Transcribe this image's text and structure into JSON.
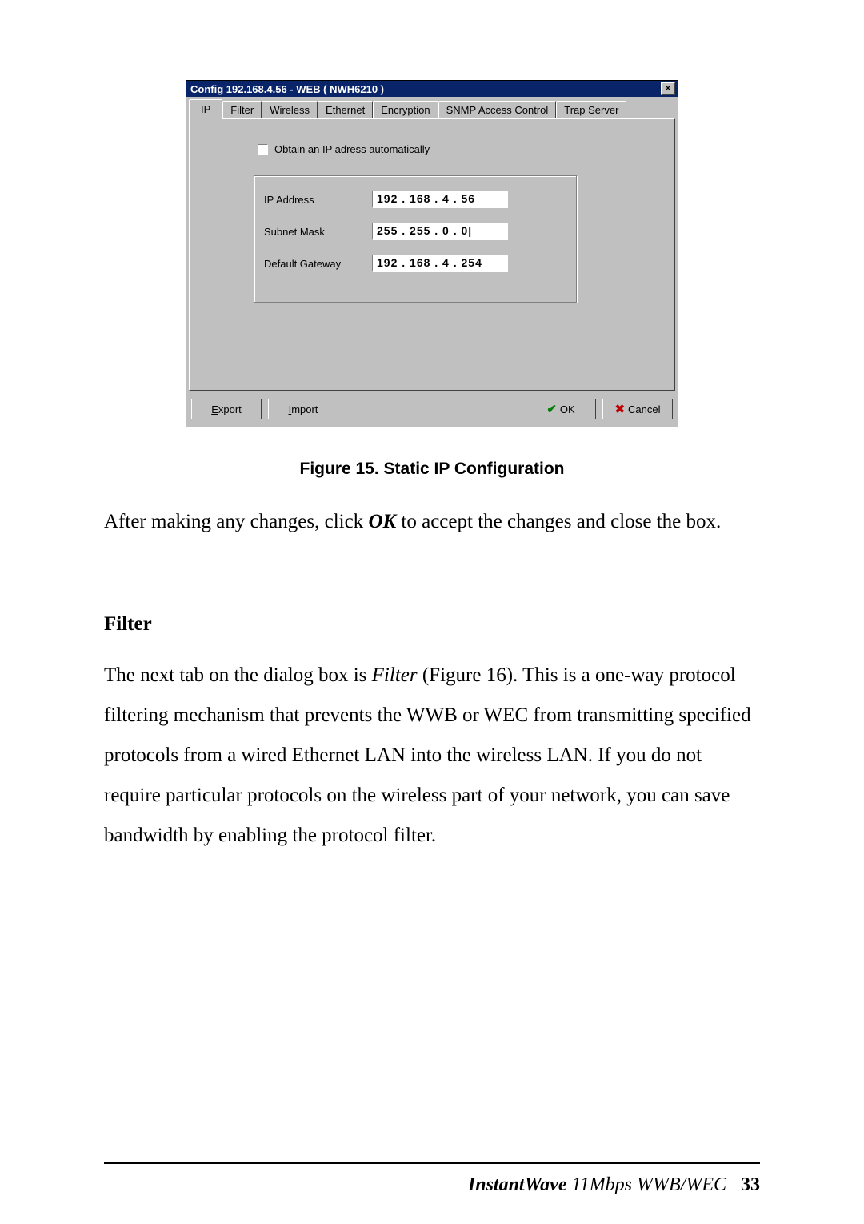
{
  "dialog": {
    "title": "Config 192.168.4.56 - WEB ( NWH6210 )",
    "tabs": [
      "IP",
      "Filter",
      "Wireless",
      "Ethernet",
      "Encryption",
      "SNMP Access Control",
      "Trap Server"
    ],
    "active_tab_index": 0,
    "checkbox_label": "Obtain an IP adress automatically",
    "fields": {
      "ip_label": "IP Address",
      "ip_value": "192 . 168 .  4  . 56",
      "mask_label": "Subnet Mask",
      "mask_value": "255 . 255 .  0  .  0|",
      "gw_label": "Default Gateway",
      "gw_value": "192 . 168 .  4  . 254"
    },
    "buttons": {
      "export": "Export",
      "import": "Import",
      "ok": "OK",
      "cancel": "Cancel"
    }
  },
  "figure_caption": "Figure 15.    Static IP Configuration",
  "para1_pre": "After making any changes, click ",
  "para1_ok": "OK",
  "para1_post": " to accept the changes and close the box.",
  "section_heading": "Filter",
  "para2_a": "The next tab on the dialog box is ",
  "para2_filter": "Filter",
  "para2_b": " (Figure 16).    This is a one-way protocol filtering mechanism that prevents the WWB or WEC from transmitting specified protocols from a wired Ethernet LAN into the wireless LAN.    If you do not require particular protocols on the wireless part of your network, you can save bandwidth by enabling the protocol filter.",
  "footer": {
    "brand": "InstantWave",
    "sub": " 11Mbps WWB/WEC",
    "page": "33"
  }
}
